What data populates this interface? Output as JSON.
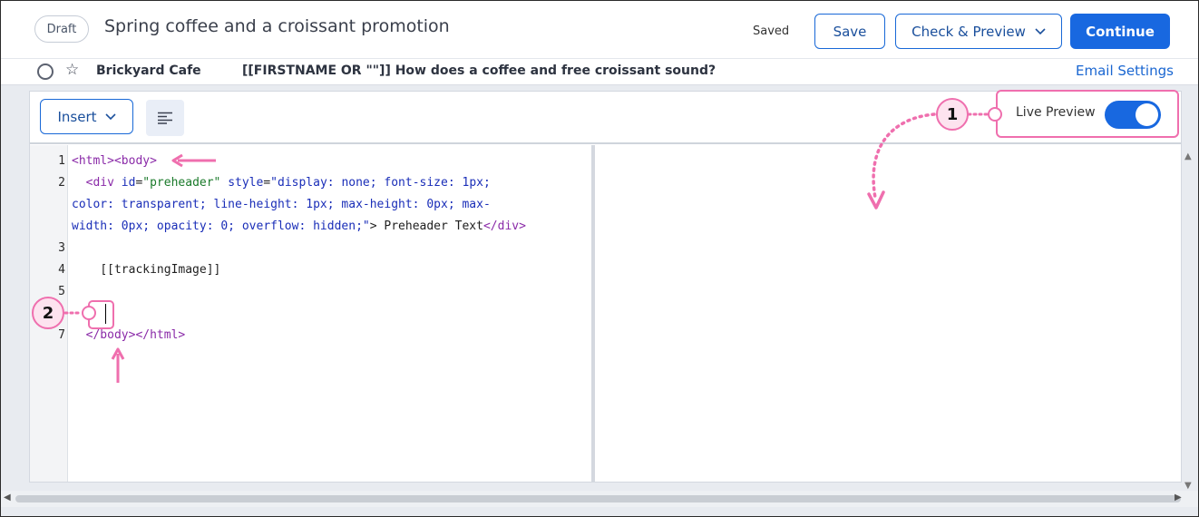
{
  "header": {
    "status_badge": "Draft",
    "campaign_title": "Spring coffee and a croissant promotion",
    "saved_text": "Saved",
    "save_label": "Save",
    "check_preview_label": "Check & Preview",
    "continue_label": "Continue"
  },
  "subject_bar": {
    "from_name": "Brickyard Cafe",
    "subject": "[[FIRSTNAME OR \"\"]] How does a coffee and free croissant sound?",
    "settings_link": "Email Settings"
  },
  "toolbar": {
    "insert_label": "Insert",
    "live_preview_label": "Live Preview",
    "live_preview_on": true
  },
  "code": {
    "line_numbers": [
      "1",
      "2",
      "3",
      "4",
      "5",
      "6",
      "7"
    ],
    "line1_a": "<html>",
    "line1_b": "<body>",
    "line2_open": "<div",
    "line2_id_attr": "id",
    "line2_id_val": "\"preheader\"",
    "line2_style_attr": "style",
    "line2_style_val_1": "\"display: none; font-size: 1px;",
    "line2_style_val_2": "color: transparent; line-height: 1px; max-height: 0px; max-",
    "line2_style_val_3": "width: 0px; opacity: 0; overflow: hidden;\"",
    "line2_text": "> Preheader Text",
    "line2_close": "</div>",
    "line4": "[[trackingImage]]",
    "line7_a": "</body>",
    "line7_b": "</html>"
  },
  "callouts": {
    "one": "1",
    "two": "2"
  },
  "colors": {
    "accent_blue": "#1868e0",
    "callout_pink": "#ef6fae",
    "tag_purple": "#8a2aa8",
    "attr_blue": "#1a2eb8",
    "string_green": "#1a7a2a"
  }
}
